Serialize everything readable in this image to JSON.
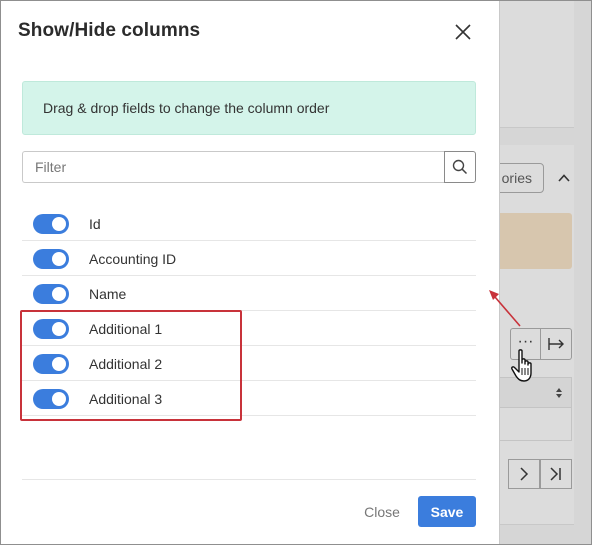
{
  "modal": {
    "title": "Show/Hide columns",
    "info_text": "Drag & drop fields to change the column order",
    "filter_placeholder": "Filter",
    "columns": [
      {
        "label": "Id",
        "enabled": true
      },
      {
        "label": "Accounting ID",
        "enabled": true
      },
      {
        "label": "Name",
        "enabled": true
      },
      {
        "label": "Additional 1",
        "enabled": true
      },
      {
        "label": "Additional 2",
        "enabled": true
      },
      {
        "label": "Additional 3",
        "enabled": true
      }
    ],
    "close_label": "Close",
    "save_label": "Save"
  },
  "background": {
    "categories_button_partial": "ories",
    "dots_label": "···"
  },
  "colors": {
    "accent": "#3b7ddd",
    "info_bg": "#d4f4ea",
    "highlight": "#c8323a"
  }
}
